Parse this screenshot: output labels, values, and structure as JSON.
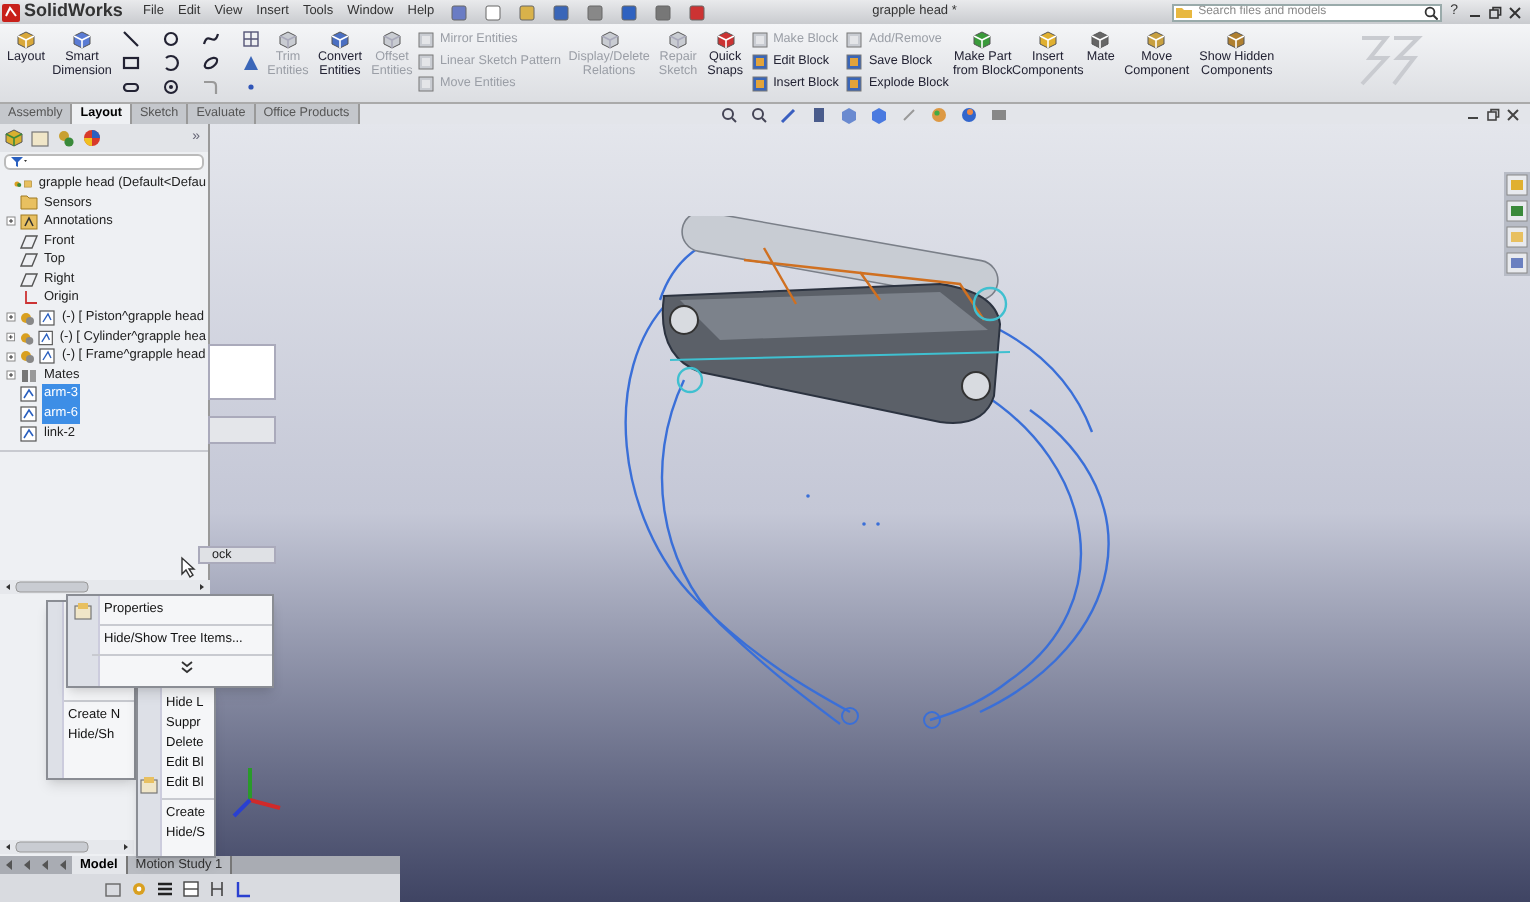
{
  "app": {
    "logo": "SolidWorks",
    "menus": [
      "File",
      "Edit",
      "View",
      "Insert",
      "Tools",
      "Window",
      "Help"
    ],
    "title": "grapple head *",
    "search": {
      "placeholder": "Search files and models"
    },
    "help": "?"
  },
  "ribbon": [
    {
      "kind": "large",
      "label": "Layout",
      "disabled": false
    },
    {
      "kind": "large",
      "label": "Smart Dimension",
      "disabled": false
    },
    {
      "kind": "sketch_tools"
    },
    {
      "kind": "large",
      "label": "Trim Entities",
      "disabled": true
    },
    {
      "kind": "large",
      "label": "Convert Entities",
      "disabled": false
    },
    {
      "kind": "large",
      "label": "Offset Entities",
      "disabled": true
    },
    {
      "kind": "list",
      "entries": [
        {
          "label": "Mirror Entities",
          "disabled": true
        },
        {
          "label": "Linear Sketch Pattern",
          "disabled": true
        },
        {
          "label": "Move Entities",
          "disabled": true
        }
      ]
    },
    {
      "kind": "large",
      "label": "Display/Delete Relations",
      "disabled": true
    },
    {
      "kind": "large",
      "label": "Repair Sketch",
      "disabled": true
    },
    {
      "kind": "large",
      "label": "Quick Snaps",
      "disabled": false
    },
    {
      "kind": "list",
      "entries": [
        {
          "label": "Make Block",
          "disabled": true
        },
        {
          "label": "Edit Block",
          "disabled": false
        },
        {
          "label": "Insert Block",
          "disabled": false
        }
      ]
    },
    {
      "kind": "list",
      "entries": [
        {
          "label": "Add/Remove",
          "disabled": true
        },
        {
          "label": "Save Block",
          "disabled": false
        },
        {
          "label": "Explode Block",
          "disabled": false
        }
      ]
    },
    {
      "kind": "large",
      "label": "Make Part from Block",
      "disabled": false
    },
    {
      "kind": "large",
      "label": "Insert Components",
      "disabled": false
    },
    {
      "kind": "large",
      "label": "Mate",
      "disabled": false
    },
    {
      "kind": "large",
      "label": "Move Component",
      "disabled": false
    },
    {
      "kind": "large",
      "label": "Show Hidden Components",
      "disabled": false
    }
  ],
  "tabs": [
    {
      "label": "Assembly",
      "selected": false
    },
    {
      "label": "Layout",
      "selected": true
    },
    {
      "label": "Sketch",
      "selected": false
    },
    {
      "label": "Evaluate",
      "selected": false
    },
    {
      "label": "Office Products",
      "selected": false
    }
  ],
  "tree": {
    "more": "»",
    "items": [
      {
        "label": "grapple head  (Default<Defau",
        "kind": "assembly",
        "expandable": false,
        "selected": false,
        "children": [
          {
            "label": "Sensors",
            "kind": "folder",
            "expandable": false,
            "selected": false
          },
          {
            "label": "Annotations",
            "kind": "annotation",
            "expandable": true,
            "selected": false
          },
          {
            "label": "Front",
            "kind": "plane",
            "expandable": false,
            "selected": false
          },
          {
            "label": "Top",
            "kind": "plane",
            "expandable": false,
            "selected": false
          },
          {
            "label": "Right",
            "kind": "plane",
            "expandable": false,
            "selected": false
          },
          {
            "label": "Origin",
            "kind": "origin",
            "expandable": false,
            "selected": false
          },
          {
            "label": "(-) [ Piston^grapple head",
            "kind": "component",
            "expandable": true,
            "selected": false
          },
          {
            "label": "(-) [ Cylinder^grapple hea",
            "kind": "component",
            "expandable": true,
            "selected": false
          },
          {
            "label": "(-) [ Frame^grapple head",
            "kind": "component",
            "expandable": true,
            "selected": false
          },
          {
            "label": "Mates",
            "kind": "mates",
            "expandable": true,
            "selected": false
          },
          {
            "label": "arm-3",
            "kind": "sketch",
            "expandable": false,
            "selected": true
          },
          {
            "label": "arm-6",
            "kind": "sketch",
            "expandable": false,
            "selected": true
          },
          {
            "label": "link-2",
            "kind": "sketch",
            "expandable": false,
            "selected": false
          }
        ]
      }
    ]
  },
  "hidden_panel": {
    "label": "ock"
  },
  "context_menus": [
    {
      "items": [
        {
          "label": "Properties",
          "separator_before": false,
          "has_icon": true
        },
        {
          "label": "Hide/Show Tree Items...",
          "separator_before": true,
          "has_icon": false
        }
      ]
    },
    {
      "items": [
        {
          "label": "Create N",
          "separator_before": true,
          "has_icon": false
        },
        {
          "label": "Hide/Sh",
          "separator_before": false,
          "has_icon": false
        }
      ]
    },
    {
      "items": [
        {
          "label": "Hide L",
          "separator_before": false,
          "has_icon": false
        },
        {
          "label": "Suppr",
          "separator_before": false,
          "has_icon": false
        },
        {
          "label": "Delete",
          "separator_before": false,
          "has_icon": false
        },
        {
          "label": "Edit Bl",
          "separator_before": false,
          "has_icon": false
        },
        {
          "label": "Edit Bl",
          "separator_before": false,
          "has_icon": true
        },
        {
          "label": "Create",
          "separator_before": true,
          "has_icon": false
        },
        {
          "label": "Hide/S",
          "separator_before": false,
          "has_icon": false
        }
      ]
    }
  ],
  "bottom_tabs": [
    {
      "label": "Model",
      "selected": true
    },
    {
      "label": "Motion Study 1",
      "selected": false
    }
  ]
}
